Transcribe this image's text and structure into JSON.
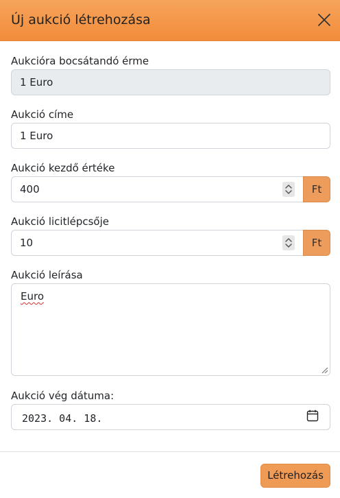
{
  "modal": {
    "title": "Új aukció létrehozása",
    "close_icon": "close-icon",
    "header_color": "#f39447"
  },
  "form": {
    "coin": {
      "label": "Aukcióra bocsátandó érme",
      "value": "1 Euro",
      "readonly": true
    },
    "title": {
      "label": "Aukció címe",
      "value": "1 Euro"
    },
    "start_price": {
      "label": "Aukció kezdő értéke",
      "value": "400",
      "addon": "Ft",
      "spinner_icon": "spinner-icon"
    },
    "bid_step": {
      "label": "Aukció licitlépcsője",
      "value": "10",
      "addon": "Ft",
      "spinner_icon": "spinner-icon"
    },
    "description": {
      "label": "Aukció leírása",
      "value": "Euro"
    },
    "end_date": {
      "label": "Aukció vég dátuma:",
      "value": "2023. 04. 18.",
      "icon": "calendar-icon"
    }
  },
  "footer": {
    "submit_label": "Létrehozás"
  },
  "colors": {
    "accent": "#ef9b55",
    "readonly_bg": "#e9ecef",
    "border": "#ced4da"
  }
}
